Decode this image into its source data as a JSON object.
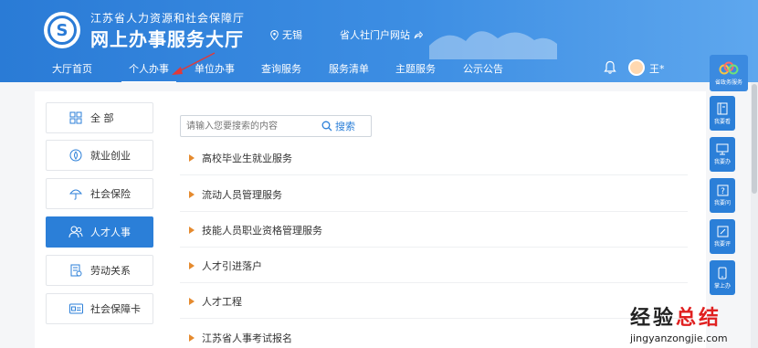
{
  "header": {
    "org_name": "江苏省人力资源和社会保障厅",
    "site_title": "网上办事服务大厅",
    "location": "无锡",
    "portal_link": "省人社门户网站",
    "user_name": "王*"
  },
  "nav": {
    "items": [
      {
        "label": "大厅首页"
      },
      {
        "label": "个人办事"
      },
      {
        "label": "单位办事"
      },
      {
        "label": "查询服务"
      },
      {
        "label": "服务清单"
      },
      {
        "label": "主题服务"
      },
      {
        "label": "公示公告"
      }
    ],
    "active": "个人办事"
  },
  "menu": {
    "items": [
      {
        "label": "全 部",
        "icon": "grid-icon"
      },
      {
        "label": "就业创业",
        "icon": "compass-icon"
      },
      {
        "label": "社会保险",
        "icon": "umbrella-icon"
      },
      {
        "label": "人才人事",
        "icon": "people-icon"
      },
      {
        "label": "劳动关系",
        "icon": "document-icon"
      },
      {
        "label": "社会保障卡",
        "icon": "card-icon"
      }
    ],
    "active": "人才人事"
  },
  "search": {
    "placeholder": "请输入您要搜索的内容",
    "button_label": "搜索"
  },
  "services": [
    {
      "label": "高校毕业生就业服务"
    },
    {
      "label": "流动人员管理服务"
    },
    {
      "label": "技能人员职业资格管理服务"
    },
    {
      "label": "人才引进落户"
    },
    {
      "label": "人才工程"
    },
    {
      "label": "江苏省人事考试报名"
    }
  ],
  "sidebar": {
    "items": [
      {
        "label": "省政务服务",
        "icon": "app-logo-icon"
      },
      {
        "label": "我要看",
        "icon": "book-icon"
      },
      {
        "label": "我要办",
        "icon": "monitor-icon"
      },
      {
        "label": "我要问",
        "icon": "question-icon"
      },
      {
        "label": "我要评",
        "icon": "edit-icon"
      },
      {
        "label": "掌上办",
        "icon": "phone-icon"
      }
    ]
  },
  "watermark": {
    "line1_a": "经验",
    "line1_b": "总结",
    "line2": "jingyanzongjie.com"
  },
  "colors": {
    "header_blue": "#2a7bd6",
    "active_blue": "#2b7fd8",
    "bullet_orange": "#e58a2e",
    "arrow_red": "#e03a3a"
  }
}
